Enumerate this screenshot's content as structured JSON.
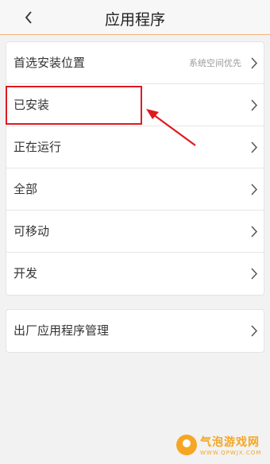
{
  "header": {
    "title": "应用程序"
  },
  "settings": {
    "items": [
      {
        "label": "首选安装位置",
        "value": "系统空间优先"
      },
      {
        "label": "已安装"
      },
      {
        "label": "正在运行"
      },
      {
        "label": "全部"
      },
      {
        "label": "可移动"
      },
      {
        "label": "开发"
      }
    ]
  },
  "factory": {
    "label": "出厂应用程序管理"
  },
  "watermark": {
    "name": "气泡游戏网",
    "url": "WWW.QPWJX.COM"
  },
  "colors": {
    "accent": "#e0191f",
    "header_border": "#f0b47a",
    "watermark": "#f5a623"
  }
}
